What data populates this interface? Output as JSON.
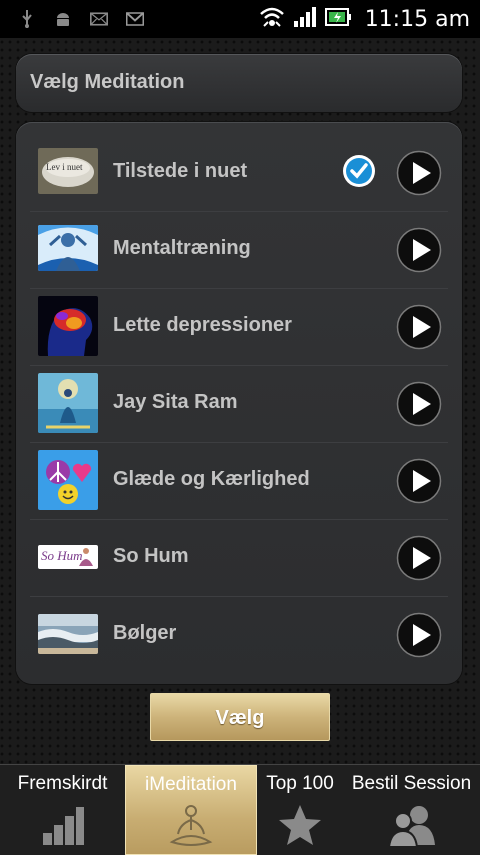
{
  "status_bar": {
    "time": "11:15 am",
    "icons": [
      "usb-icon",
      "android-icon",
      "email-icon",
      "gmail-icon",
      "wifi-icon",
      "signal-icon",
      "battery-icon"
    ]
  },
  "header": {
    "title": "Vælg Meditation"
  },
  "meditations": [
    {
      "label": "Tilstede i nuet",
      "selected": true,
      "thumb_text": "Lev i nuet"
    },
    {
      "label": "Mentaltræning",
      "selected": false
    },
    {
      "label": "Lette depressioner",
      "selected": false
    },
    {
      "label": "Jay Sita Ram",
      "selected": false
    },
    {
      "label": "Glæde og Kærlighed",
      "selected": false
    },
    {
      "label": "So Hum",
      "selected": false,
      "thumb_text": "So Hum"
    },
    {
      "label": "Bølger",
      "selected": false
    }
  ],
  "select_button": {
    "label": "Vælg"
  },
  "tabs": [
    {
      "label": "Fremskirdt",
      "icon": "bar-chart-icon",
      "active": false
    },
    {
      "label": "iMeditation",
      "icon": "meditation-pose-icon",
      "active": true
    },
    {
      "label": "Top 100",
      "icon": "star-icon",
      "active": false
    },
    {
      "label": "Bestil Session",
      "icon": "people-icon",
      "active": false
    }
  ],
  "colors": {
    "accent_gold": "#c8ad72",
    "check_blue": "#1a8fd6",
    "panel": "#2f3032"
  }
}
